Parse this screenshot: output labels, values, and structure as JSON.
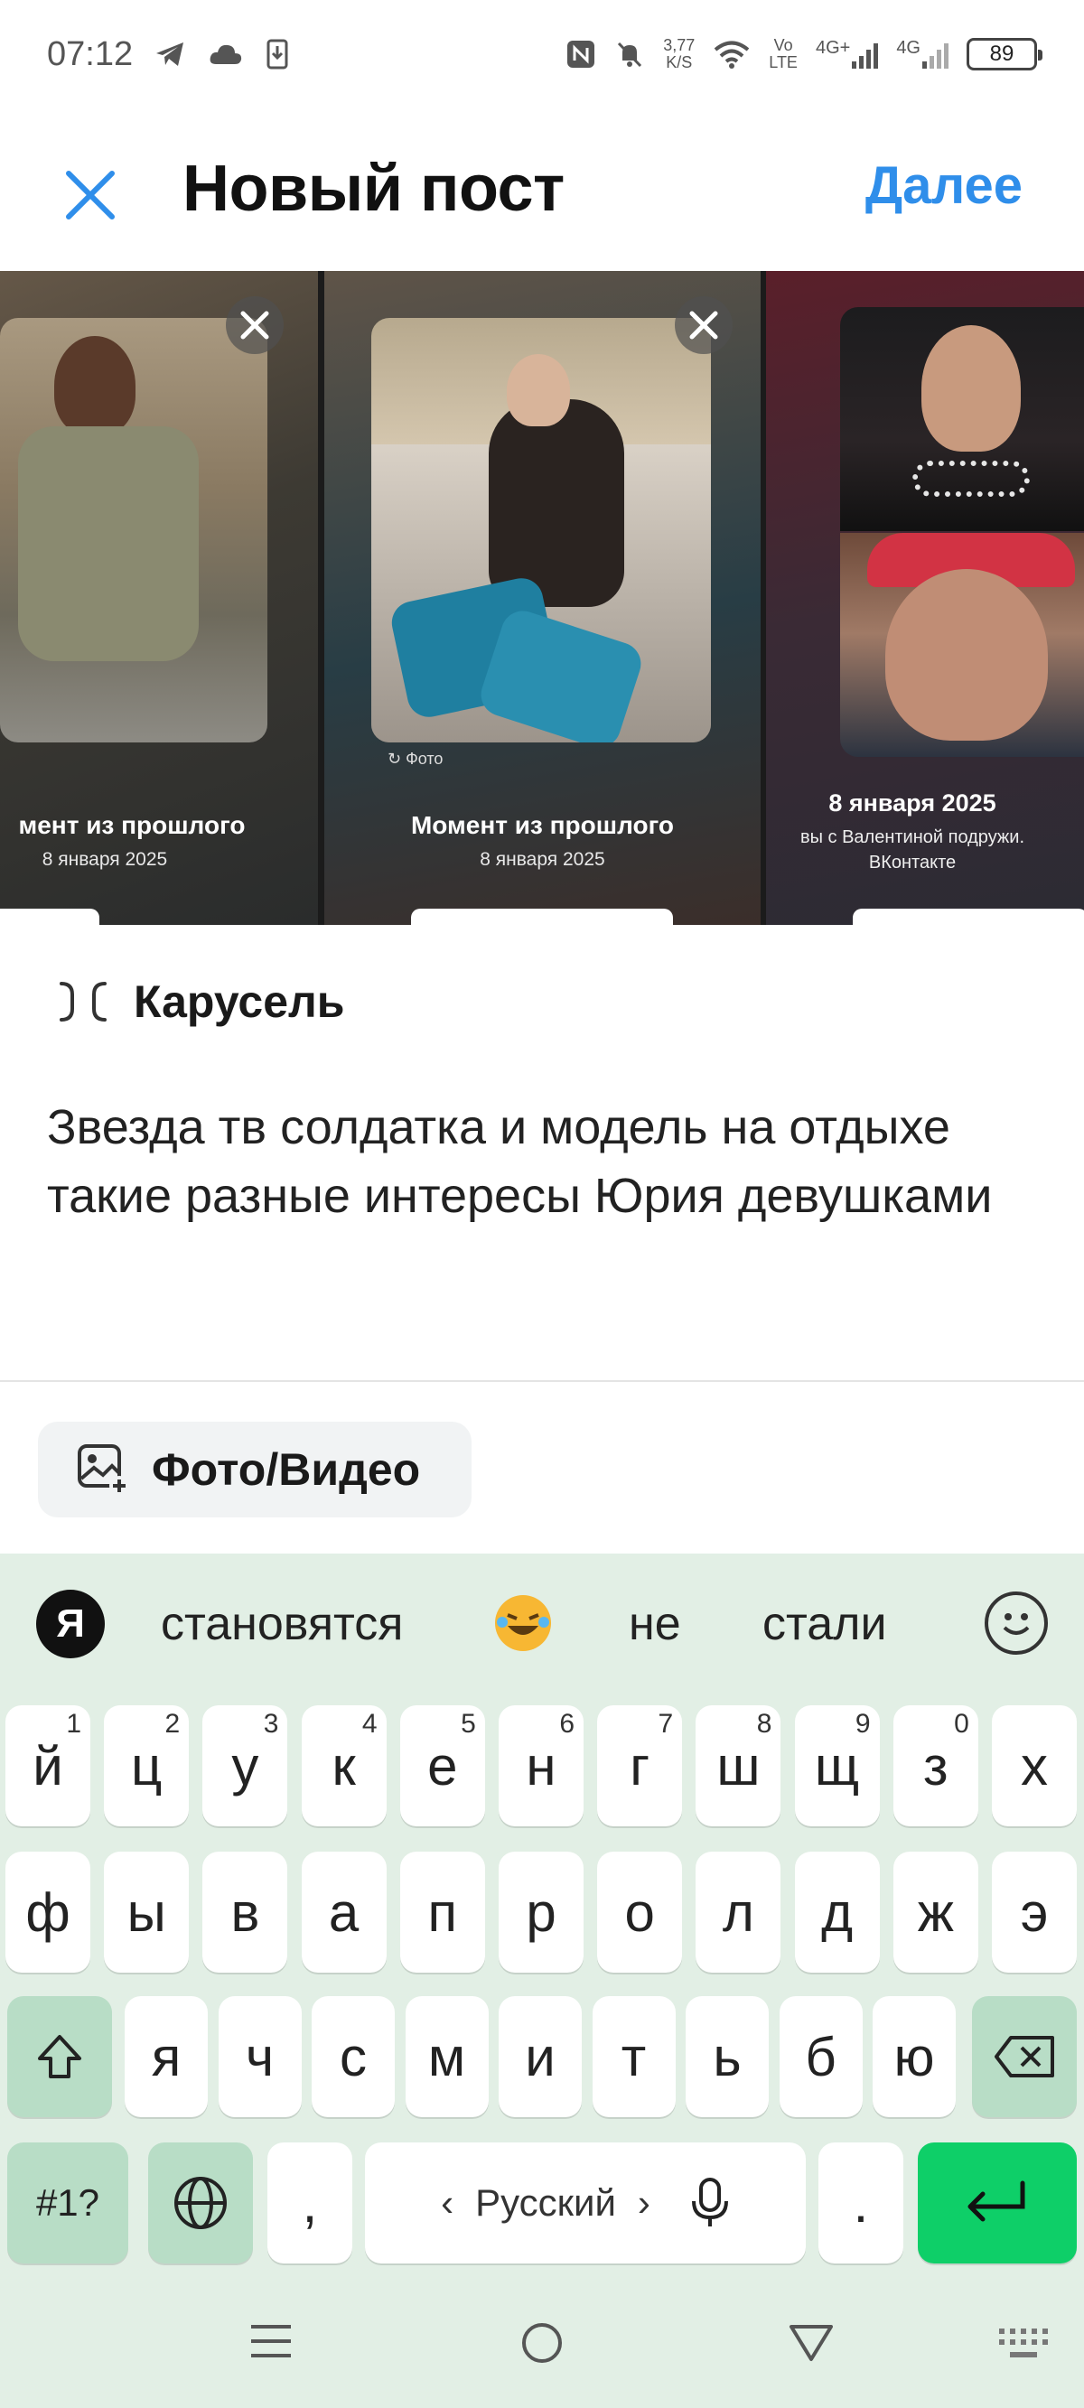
{
  "status_bar": {
    "time": "07:12",
    "net_speed_value": "3,77",
    "net_speed_unit": "K/S",
    "volte_top": "Vo",
    "volte_bottom": "LTE",
    "sim1": "4G+",
    "sim2": "4G",
    "battery": "89"
  },
  "header": {
    "title": "Новый пост",
    "next_label": "Далее"
  },
  "carousel": {
    "slides": [
      {
        "title": "мент из прошлого",
        "date": "8 января 2025"
      },
      {
        "source": "Фото",
        "title": "Момент из прошлого",
        "date": "8 января 2025"
      },
      {
        "title": "8 января 2025",
        "line1": "вы с Валентиной подружи.",
        "line2": "ВКонтакте"
      }
    ]
  },
  "mode": {
    "label": "Карусель"
  },
  "post": {
    "text": "Звезда тв солдатка и модель на отдыхе такие разные интересы Юрия девушками"
  },
  "media_button": {
    "label": "Фото/Видео"
  },
  "keyboard": {
    "logo": "Я",
    "suggestions": [
      "становятся",
      "не",
      "стали"
    ],
    "row1": [
      {
        "k": "й",
        "h": "1"
      },
      {
        "k": "ц",
        "h": "2"
      },
      {
        "k": "у",
        "h": "3"
      },
      {
        "k": "к",
        "h": "4"
      },
      {
        "k": "е",
        "h": "5"
      },
      {
        "k": "н",
        "h": "6"
      },
      {
        "k": "г",
        "h": "7"
      },
      {
        "k": "ш",
        "h": "8"
      },
      {
        "k": "щ",
        "h": "9"
      },
      {
        "k": "з",
        "h": "0"
      },
      {
        "k": "х",
        "h": ""
      }
    ],
    "row2": [
      "ф",
      "ы",
      "в",
      "а",
      "п",
      "р",
      "о",
      "л",
      "д",
      "ж",
      "э"
    ],
    "row3": [
      "я",
      "ч",
      "с",
      "м",
      "и",
      "т",
      "ь",
      "б",
      "ю"
    ],
    "symbols": "#1?",
    "comma": ",",
    "language": "Русский",
    "period": "."
  },
  "icons": {
    "close": "close-icon",
    "next": "next-link",
    "carousel": "carousel-icon",
    "media": "add-photo-icon",
    "shift": "shift-icon",
    "backspace": "backspace-icon",
    "globe": "globe-icon",
    "mic": "microphone-icon",
    "enter": "enter-icon"
  },
  "colors": {
    "accent": "#2f8eea",
    "keyboard_bg": "#e2efe5",
    "func_key": "#b8ddc6",
    "enter_key": "#0ecf68"
  }
}
